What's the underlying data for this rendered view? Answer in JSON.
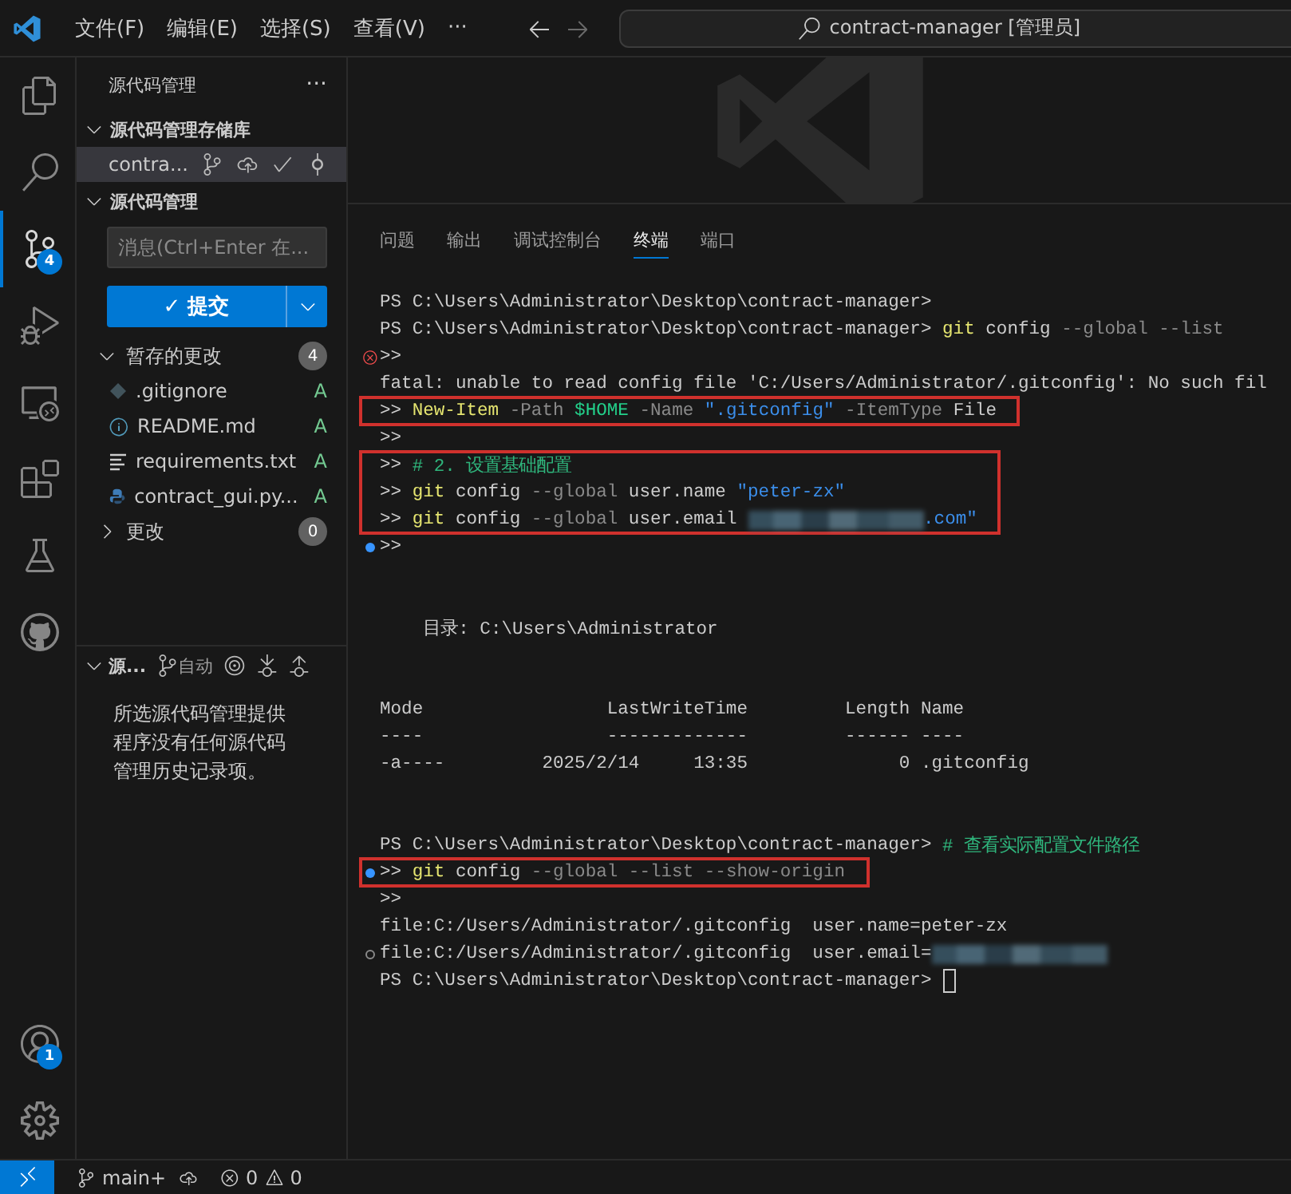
{
  "title_bar": {
    "menus": [
      "文件(F)",
      "编辑(E)",
      "选择(S)",
      "查看(V)"
    ],
    "more": "···",
    "search": "contract-manager [管理员]"
  },
  "activity_bar": {
    "items": [
      {
        "kind": "files",
        "selected": false
      },
      {
        "kind": "search",
        "selected": false
      },
      {
        "kind": "source-control",
        "selected": true,
        "badge": "4"
      },
      {
        "kind": "debug",
        "selected": false
      },
      {
        "kind": "remote",
        "selected": false
      },
      {
        "kind": "extensions",
        "selected": false
      },
      {
        "kind": "testing",
        "selected": false
      },
      {
        "kind": "github",
        "selected": false
      }
    ],
    "bottom": [
      {
        "kind": "account",
        "badge": "1"
      },
      {
        "kind": "settings"
      }
    ]
  },
  "sidebar": {
    "title": "源代码管理",
    "more": "···",
    "repositories": {
      "title": "源代码管理存储库",
      "expanded": true,
      "repo": {
        "name": "contra...",
        "selected": true
      }
    },
    "changes_section": {
      "title": "源代码管理",
      "expanded": true,
      "message_placeholder": "消息(Ctrl+Enter 在...",
      "commit_button": "✓ 提交",
      "groups": [
        {
          "title": "暂存的更改",
          "count": "4",
          "expanded": true,
          "files": [
            {
              "name": ".gitignore",
              "kind": "gitignore",
              "status": "A"
            },
            {
              "name": "README.md",
              "kind": "markdown",
              "status": "A"
            },
            {
              "name": "requirements.txt",
              "kind": "text",
              "status": "A"
            },
            {
              "name": "contract_gui.py...",
              "kind": "python",
              "status": "A"
            }
          ]
        },
        {
          "title": "更改",
          "count": "0",
          "expanded": false
        }
      ]
    },
    "graph": {
      "title": "源...",
      "expanded": true,
      "branch_mode": "自动",
      "message": "所选源代码管理提供程序没有任何源代码管理历史记录项。"
    }
  },
  "panel": {
    "tabs": [
      {
        "label": "问题",
        "selected": false
      },
      {
        "label": "输出",
        "selected": false
      },
      {
        "label": "调试控制台",
        "selected": false
      },
      {
        "label": "终端",
        "selected": true
      },
      {
        "label": "端口",
        "selected": false
      }
    ],
    "terminal": [
      {
        "highlighted": false,
        "lines": [
          {
            "segments": [
              {
                "kind": "plain",
                "text": "PS C:\\Users\\Administrator\\Desktop\\contract-manager>"
              }
            ]
          },
          {
            "segments": [
              {
                "kind": "plain",
                "text": "PS C:\\Users\\Administrator\\Desktop\\contract-manager> "
              },
              {
                "kind": "command",
                "text": "git"
              },
              {
                "kind": "plain",
                "text": " config "
              },
              {
                "kind": "param",
                "text": "--global --list"
              }
            ]
          },
          {
            "kind": "error",
            "segments": [
              {
                "kind": "plain",
                "text": ">>"
              }
            ]
          },
          {
            "segments": [
              {
                "kind": "plain",
                "text": "fatal: unable to read config file 'C:/Users/Administrator/.gitconfig': No such fil"
              }
            ]
          }
        ]
      },
      {
        "highlighted": true,
        "lines": [
          {
            "segments": [
              {
                "kind": "plain",
                "text": ">> "
              },
              {
                "kind": "command",
                "text": "New-Item"
              },
              {
                "kind": "param",
                "text": " -Path "
              },
              {
                "kind": "variable",
                "text": "$HOME"
              },
              {
                "kind": "param",
                "text": " -Name "
              },
              {
                "kind": "string",
                "text": "\".gitconfig\""
              },
              {
                "kind": "param",
                "text": " -ItemType"
              },
              {
                "kind": "plain",
                "text": " File"
              }
            ]
          }
        ]
      },
      {
        "highlighted": false,
        "lines": [
          {
            "segments": [
              {
                "kind": "plain",
                "text": ">>"
              }
            ]
          }
        ]
      },
      {
        "highlighted": true,
        "lines": [
          {
            "segments": [
              {
                "kind": "plain",
                "text": ">> "
              },
              {
                "kind": "comment",
                "text": "# 2. 设置基础配置"
              }
            ]
          },
          {
            "segments": [
              {
                "kind": "plain",
                "text": ">> "
              },
              {
                "kind": "command",
                "text": "git"
              },
              {
                "kind": "plain",
                "text": " config "
              },
              {
                "kind": "param",
                "text": "--global"
              },
              {
                "kind": "plain",
                "text": " user.name "
              },
              {
                "kind": "string",
                "text": "\"peter-zx\""
              }
            ]
          },
          {
            "segments": [
              {
                "kind": "plain",
                "text": ">> "
              },
              {
                "kind": "command",
                "text": "git"
              },
              {
                "kind": "plain",
                "text": " config "
              },
              {
                "kind": "param",
                "text": "--global"
              },
              {
                "kind": "plain",
                "text": " user.email "
              },
              {
                "kind": "redacted"
              },
              {
                "kind": "string",
                "text": ".com\""
              }
            ]
          }
        ]
      },
      {
        "highlighted": false,
        "lines": [
          {
            "kind": "info",
            "segments": [
              {
                "kind": "plain",
                "text": ">>"
              }
            ]
          },
          {
            "kind": "blank"
          },
          {
            "kind": "blank"
          },
          {
            "segments": [
              {
                "kind": "plain",
                "text": "    目录: C:\\Users\\Administrator"
              }
            ]
          },
          {
            "kind": "blank"
          },
          {
            "kind": "blank"
          },
          {
            "segments": [
              {
                "kind": "plain",
                "text": "Mode                 LastWriteTime         Length Name"
              }
            ]
          },
          {
            "segments": [
              {
                "kind": "plain",
                "text": "----                 -------------         ------ ----"
              }
            ]
          },
          {
            "segments": [
              {
                "kind": "plain",
                "text": "-a----         2025/2/14     13:35              0 .gitconfig"
              }
            ]
          },
          {
            "kind": "blank"
          },
          {
            "kind": "blank"
          },
          {
            "segments": [
              {
                "kind": "plain",
                "text": "PS C:\\Users\\Administrator\\Desktop\\contract-manager> "
              },
              {
                "kind": "comment",
                "text": "# 查看实际配置文件路径"
              }
            ]
          }
        ]
      },
      {
        "highlighted": true,
        "lines": [
          {
            "kind": "info",
            "segments": [
              {
                "kind": "plain",
                "text": ">> "
              },
              {
                "kind": "command",
                "text": "git"
              },
              {
                "kind": "plain",
                "text": " config "
              },
              {
                "kind": "param",
                "text": "--global --list --show-origin"
              }
            ]
          }
        ]
      },
      {
        "highlighted": false,
        "lines": [
          {
            "segments": [
              {
                "kind": "plain",
                "text": ">>"
              }
            ]
          },
          {
            "segments": [
              {
                "kind": "plain",
                "text": "file:C:/Users/Administrator/.gitconfig  user.name=peter-zx"
              }
            ]
          },
          {
            "kind": "empty",
            "segments": [
              {
                "kind": "plain",
                "text": "file:C:/Users/Administrator/.gitconfig  user.email="
              },
              {
                "kind": "redacted"
              }
            ]
          },
          {
            "segments": [
              {
                "kind": "plain",
                "text": "PS C:\\Users\\Administrator\\Desktop\\contract-manager> "
              },
              {
                "kind": "cursor"
              }
            ]
          }
        ]
      }
    ]
  },
  "status_bar": {
    "branch": "main+",
    "errors": "0",
    "warnings": "0"
  }
}
